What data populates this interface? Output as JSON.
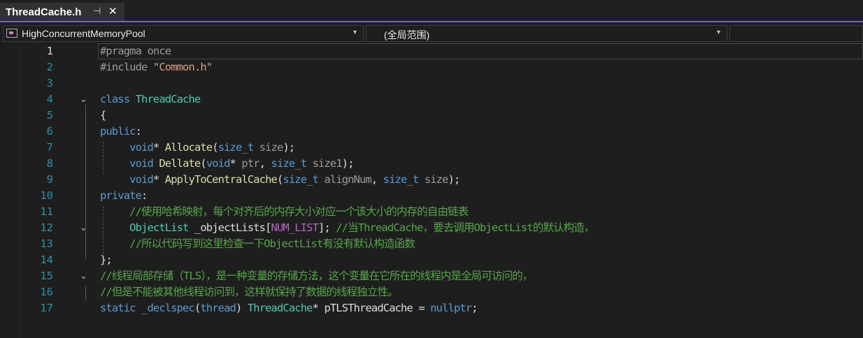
{
  "tab": {
    "title": "ThreadCache.h",
    "pin_glyph": "⊣",
    "close_glyph": "✕"
  },
  "nav": {
    "project": "HighConcurrentMemoryPool",
    "scope": "(全局范围)",
    "arrow": "▾"
  },
  "editor": {
    "fold_glyph": "⌄",
    "lines": [
      {
        "n": "1",
        "tokens": [
          {
            "c": "pre",
            "t": "#pragma once"
          }
        ]
      },
      {
        "n": "2",
        "tokens": [
          {
            "c": "pre",
            "t": "#include "
          },
          {
            "c": "str",
            "t": "\"Common.h\""
          }
        ]
      },
      {
        "n": "3",
        "tokens": []
      },
      {
        "n": "4",
        "tokens": [
          {
            "c": "kw",
            "t": "class "
          },
          {
            "c": "type",
            "t": "ThreadCache"
          }
        ]
      },
      {
        "n": "5",
        "tokens": [
          {
            "c": "txt",
            "t": "{"
          }
        ]
      },
      {
        "n": "6",
        "tokens": [
          {
            "c": "kw",
            "t": "public"
          },
          {
            "c": "txt",
            "t": ":"
          }
        ]
      },
      {
        "n": "7",
        "tokens": [
          {
            "c": "txt",
            "t": "     "
          },
          {
            "c": "kw",
            "t": "void"
          },
          {
            "c": "txt",
            "t": "* "
          },
          {
            "c": "fn",
            "t": "Allocate"
          },
          {
            "c": "txt",
            "t": "("
          },
          {
            "c": "kw",
            "t": "size_t"
          },
          {
            "c": "pm",
            "t": " size"
          },
          {
            "c": "txt",
            "t": ");"
          }
        ]
      },
      {
        "n": "8",
        "tokens": [
          {
            "c": "txt",
            "t": "     "
          },
          {
            "c": "kw",
            "t": "void"
          },
          {
            "c": "txt",
            "t": " "
          },
          {
            "c": "fn",
            "t": "Dellate"
          },
          {
            "c": "txt",
            "t": "("
          },
          {
            "c": "kw",
            "t": "void"
          },
          {
            "c": "txt",
            "t": "*"
          },
          {
            "c": "pm",
            "t": " ptr"
          },
          {
            "c": "txt",
            "t": ", "
          },
          {
            "c": "kw",
            "t": "size_t"
          },
          {
            "c": "pm",
            "t": " size1"
          },
          {
            "c": "txt",
            "t": ");"
          }
        ]
      },
      {
        "n": "9",
        "tokens": [
          {
            "c": "txt",
            "t": "     "
          },
          {
            "c": "kw",
            "t": "void"
          },
          {
            "c": "txt",
            "t": "* "
          },
          {
            "c": "fn",
            "t": "ApplyToCentralCache"
          },
          {
            "c": "txt",
            "t": "("
          },
          {
            "c": "kw",
            "t": "size_t"
          },
          {
            "c": "pm",
            "t": " alignNum"
          },
          {
            "c": "txt",
            "t": ", "
          },
          {
            "c": "kw",
            "t": "size_t"
          },
          {
            "c": "pm",
            "t": " size"
          },
          {
            "c": "txt",
            "t": ");"
          }
        ]
      },
      {
        "n": "10",
        "tokens": [
          {
            "c": "kw",
            "t": "private"
          },
          {
            "c": "txt",
            "t": ":"
          }
        ]
      },
      {
        "n": "11",
        "tokens": [
          {
            "c": "txt",
            "t": "     "
          },
          {
            "c": "cm",
            "t": "//使用哈希映射，每个对齐后的内存大小对应一个该大小的内存的自由链表"
          }
        ]
      },
      {
        "n": "12",
        "tokens": [
          {
            "c": "txt",
            "t": "     "
          },
          {
            "c": "type",
            "t": "ObjectList"
          },
          {
            "c": "txt",
            "t": " _objectLists["
          },
          {
            "c": "mac",
            "t": "NUM_LIST"
          },
          {
            "c": "txt",
            "t": "]; "
          },
          {
            "c": "cm",
            "t": "//当ThreadCache，要去调用ObjectList的默认构造，"
          }
        ]
      },
      {
        "n": "13",
        "tokens": [
          {
            "c": "txt",
            "t": "     "
          },
          {
            "c": "cm",
            "t": "//所以代码写到这里检查一下ObjectList有没有默认构造函数"
          }
        ]
      },
      {
        "n": "14",
        "tokens": [
          {
            "c": "txt",
            "t": "};"
          }
        ]
      },
      {
        "n": "15",
        "tokens": [
          {
            "c": "cm",
            "t": "//线程局部存储（TLS），是一种变量的存储方法，这个变量在它所在的线程内是全局可访问的，"
          }
        ]
      },
      {
        "n": "16",
        "tokens": [
          {
            "c": "cm",
            "t": "//但是不能被其他线程访问到，这样就保持了数据的线程独立性。"
          }
        ]
      },
      {
        "n": "17",
        "tokens": [
          {
            "c": "kw",
            "t": "static"
          },
          {
            "c": "txt",
            "t": " "
          },
          {
            "c": "kw",
            "t": "_declspec"
          },
          {
            "c": "txt",
            "t": "("
          },
          {
            "c": "kw",
            "t": "thread"
          },
          {
            "c": "txt",
            "t": ") "
          },
          {
            "c": "type",
            "t": "ThreadCache"
          },
          {
            "c": "txt",
            "t": "* pTLSThreadCache = "
          },
          {
            "c": "kw",
            "t": "nullptr"
          },
          {
            "c": "txt",
            "t": ";"
          }
        ]
      }
    ]
  },
  "colors": {
    "accent": "#7160e8",
    "keyword": "#569cd6",
    "type": "#4ec9b0",
    "function": "#dcdcaa",
    "string": "#d69d85",
    "comment": "#57a64a",
    "line_number": "#2b91af",
    "macro": "#bd63c5"
  }
}
